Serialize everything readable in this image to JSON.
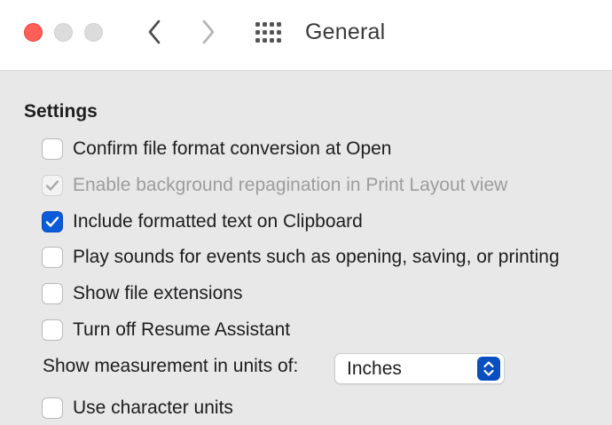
{
  "window": {
    "title": "General",
    "controls": [
      "close",
      "minimize",
      "zoom"
    ],
    "nav_icons": [
      "chevron-left-icon",
      "chevron-right-icon",
      "grid-icon"
    ]
  },
  "settings": {
    "section_title": "Settings",
    "options": [
      {
        "label": "Confirm file format conversion at Open",
        "checked": false,
        "disabled": false
      },
      {
        "label": "Enable background repagination in Print Layout view",
        "checked": true,
        "disabled": true
      },
      {
        "label": "Include formatted text on Clipboard",
        "checked": true,
        "disabled": false
      },
      {
        "label": "Play sounds for events such as opening, saving, or printing",
        "checked": false,
        "disabled": false
      },
      {
        "label": "Show file extensions",
        "checked": false,
        "disabled": false
      },
      {
        "label": "Turn off Resume Assistant",
        "checked": false,
        "disabled": false
      }
    ],
    "units": {
      "label": "Show measurement in units of:",
      "selected": "Inches"
    },
    "character_units": {
      "label": "Use character units",
      "checked": false
    }
  },
  "colors": {
    "close": "#ff5f57",
    "accent": "#0a5bd7",
    "background": "#e8e8e8",
    "titlebar": "#ffffff"
  }
}
